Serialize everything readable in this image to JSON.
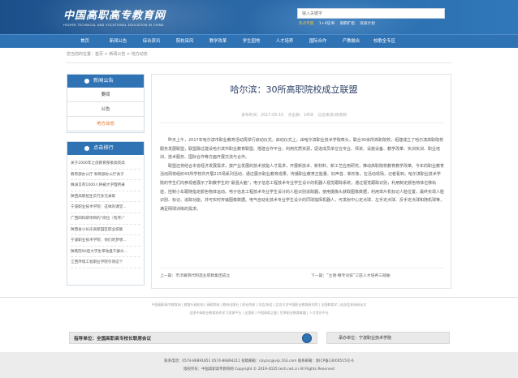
{
  "header": {
    "logo_cn": "中国高职高专教育网",
    "logo_en": "HIGHER TECHNICAL AND VOCATIONAL EDUCATION IN CHINA",
    "search_placeholder": "输入关键字",
    "hot_label": "热点专题",
    "hot_items": [
      "1+X证书",
      "高职扩招",
      "双高计划"
    ]
  },
  "nav": [
    "首页",
    "新闻公告",
    "综合资讯",
    "院校采风",
    "教学改革",
    "学生园地",
    "人才培养",
    "国际合作",
    "产教融合",
    "校歌全专区"
  ],
  "breadcrumb": "您当前的位置：首页 > 新闻公告 > 地方动态",
  "sidebar": {
    "news_title": "新闻公告",
    "news_items": [
      "要闻",
      "公告",
      "地方动态"
    ],
    "rank_title": "点击排行",
    "rank_items": [
      "关于2006年之前教育部委高校高",
      "教育部办公厅 财政部办公厅关于",
      "株洲又有1000人将被大学理所录",
      "陕西高职招生实行多元录取",
      "宁波职业技术学院：这样的课堂...",
      "广西四科研项目的“岗位（有序）”",
      "陕西省小长乐高新园区职业技能",
      "宁波职业技术学院：你们的梦想...",
      "陕铁院90后大学生带动盘千群众...",
      "江西环境工程职业学院引领这个"
    ]
  },
  "article": {
    "title": "哈尔滨：30所高职院校成立联盟",
    "date": "发布时间：2017-05-10",
    "clicks": "点击数：1458",
    "source": "信息来源:新浪网",
    "paragraphs": [
      "昨天上午，2017年哈尔滨市职业教育活动周举行启动仪式，启动仪式上，由哈尔滨职业技术学院牵头，联合30余所高职院校，组建成立了哈尔滨高职院校服务发展联盟，联盟融过建设哈尔滨市职业教育联盟、搭建合作平台，利用优质资源，促进成员单位在专业、师资、设施设备、教学改革、实训实训、职业培训、技术服务、国际合作等方面开展交流与合作。",
      "联盟还将结合本省经济发展需求，按产业发展的技术技能人才需求，开展新技术、新材料、新工艺应用研究，推动高职院校教育教学改革。今年的职业教育活动周将组织43所学校共开展215场系列活动，通过展示职业教育成果，传播职业教育正能量、好声音、新形象。在活动现场，记者看到，哈尔滨职业技术学院的学生们向参观者展示了职教学生的“最强大脑”，电子信息工程技术专业学生设计的机器人视觉跟踪系统，通过视觉跟踪识别，利用制定颜色特体位移轨迹，控制小车跟随指定颜色物体运动。电子信息工程技术专业学生设计的人脸识别追踪器，使用摄像头获取图像数据，利用单片机标记人脸位置，最终实现人脸识别、标记、追踪功能。并可实时传输图像数据。电气自动化技术专业学生设计的同球指挥机器人，可发射中心定点球、左手定点球、反手定点球和随机球等，满足网球训练的需求。"
    ],
    "prev": "上一篇：市淳属院代制造业职教集团成立",
    "next": "下一篇：“立德·精专训技”工匠人才培养三部曲"
  },
  "footer": {
    "links1": "中国高职高专教育网 | 教育行政机构 | 高职院校 | 教材出版社 | 职业院校 | 学会/协会 | 北京大学中国职业教育研究院 | 全国教育学 | 成员信息科研论文",
    "links2": "全国中高职业教育协作学习资源平台 | 全国网 | 中国高职之窗 | 世界职业教育联盟 | 人才资讯平台",
    "guide": "指导单位：全国高职高专校长联席会议",
    "host": "承办单位：宁波职业技术学院",
    "contact": "联系电话：0574-86891851  0574-86894211  投稿邮箱：nzyzsc@vip.163.com  联系邮箱：浙ICP备13000515号-6",
    "copyright": "版权所有：中国高职高专教育网  Copyright © 2019-2025 tech.net.cn All Rights Reserved"
  }
}
